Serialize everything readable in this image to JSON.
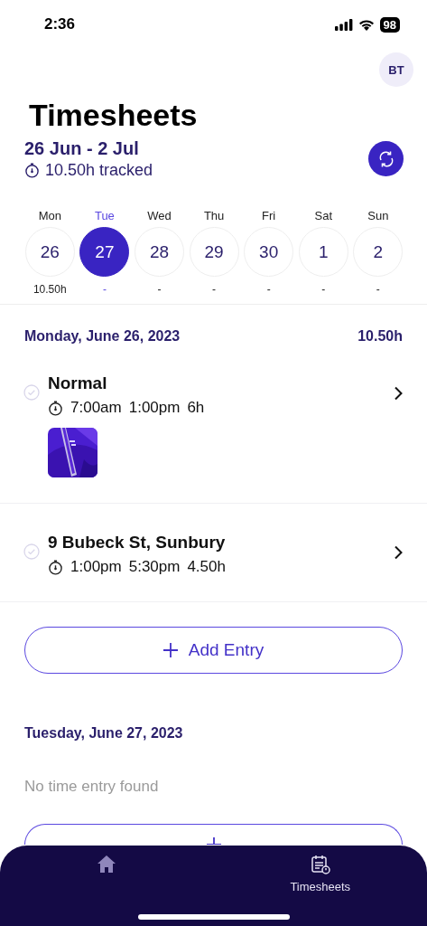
{
  "status_bar": {
    "time": "2:36",
    "battery": "98"
  },
  "header": {
    "avatar": "BT",
    "title": "Timesheets",
    "range": "26 Jun - 2 Jul",
    "tracked": "10.50h tracked"
  },
  "days": [
    {
      "name": "Mon",
      "date": "26",
      "hours": "10.50h",
      "selected": false
    },
    {
      "name": "Tue",
      "date": "27",
      "hours": "-",
      "selected": true
    },
    {
      "name": "Wed",
      "date": "28",
      "hours": "-",
      "selected": false
    },
    {
      "name": "Thu",
      "date": "29",
      "hours": "-",
      "selected": false
    },
    {
      "name": "Fri",
      "date": "30",
      "hours": "-",
      "selected": false
    },
    {
      "name": "Sat",
      "date": "1",
      "hours": "-",
      "selected": false
    },
    {
      "name": "Sun",
      "date": "2",
      "hours": "-",
      "selected": false
    }
  ],
  "sections": [
    {
      "heading": "Monday, June 26, 2023",
      "total": "10.50h",
      "entries": [
        {
          "title": "Normal",
          "start": "7:00am",
          "end": "1:00pm",
          "duration": "6h"
        },
        {
          "title": "9 Bubeck St, Sunbury",
          "start": "1:00pm",
          "end": "5:30pm",
          "duration": "4.50h"
        }
      ],
      "add_button": "Add Entry"
    },
    {
      "heading": "Tuesday, June 27, 2023",
      "empty_text": "No time entry found",
      "cut_button": true
    }
  ],
  "nav": [
    {
      "kind": "home",
      "selected": false
    },
    {
      "kind": "timesheets",
      "label": "Timesheets",
      "selected": true
    }
  ]
}
